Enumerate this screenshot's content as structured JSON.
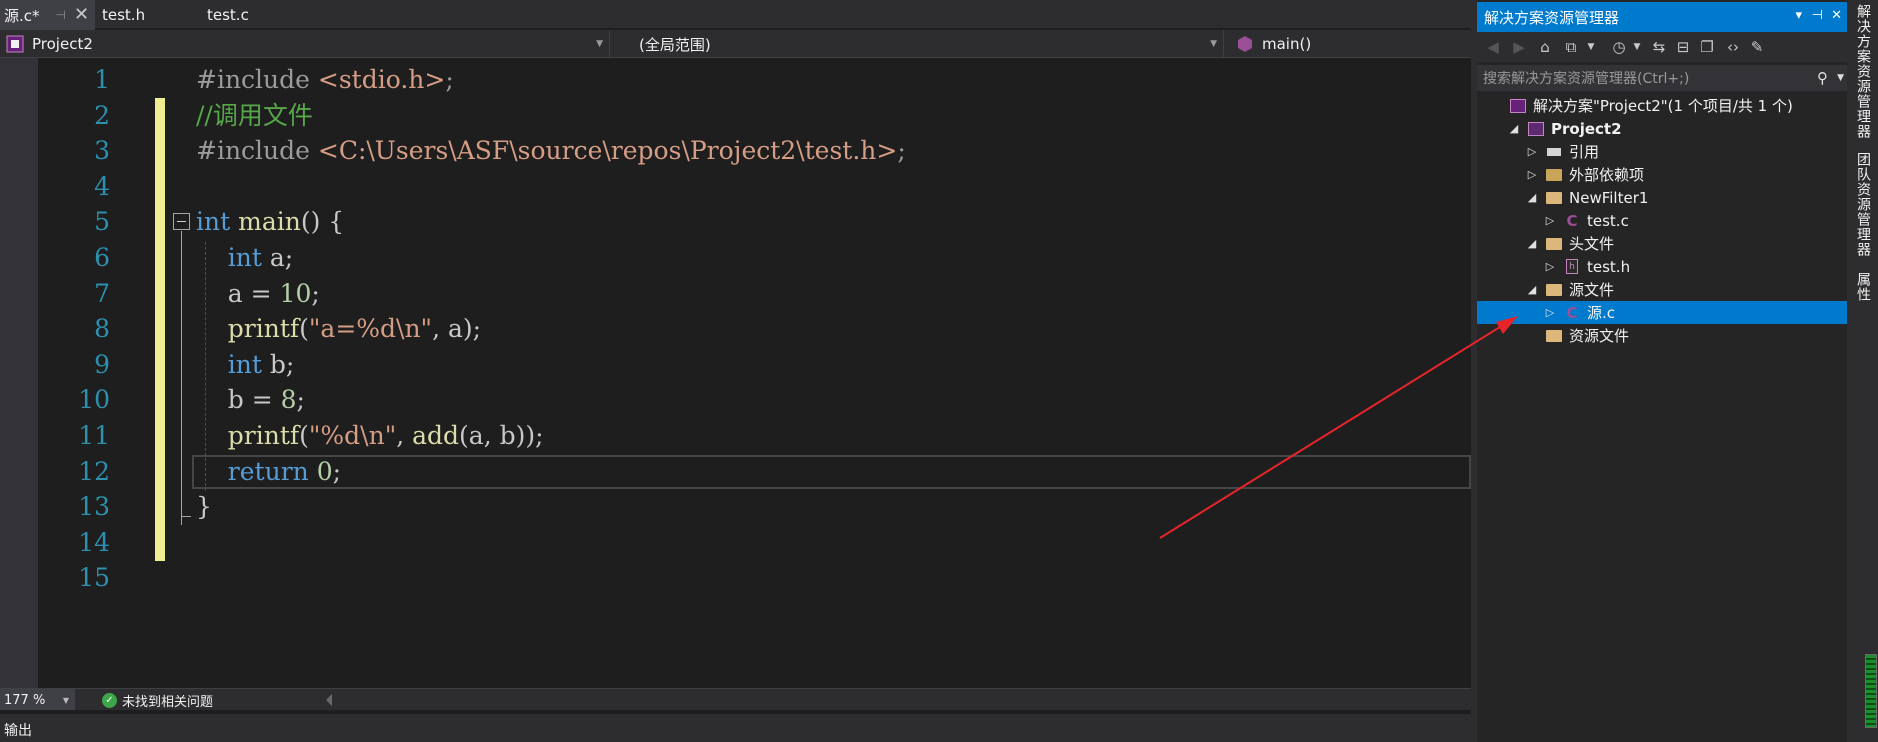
{
  "tabs": [
    {
      "label": "源.c*",
      "active": true,
      "pin": "⊣",
      "close": "✕"
    },
    {
      "label": "test.h",
      "active": false
    },
    {
      "label": "test.c",
      "active": false
    }
  ],
  "nav": {
    "project": "Project2",
    "scope": "(全局范围)",
    "member": "main()"
  },
  "editor": {
    "line_numbers": [
      "1",
      "2",
      "3",
      "4",
      "5",
      "6",
      "7",
      "8",
      "9",
      "10",
      "11",
      "12",
      "13",
      "14",
      "15"
    ],
    "lines": [
      [
        {
          "t": "#include ",
          "c": "pp"
        },
        {
          "t": "<stdio.h>",
          "c": "inc"
        },
        {
          "t": ";",
          "c": "pp"
        }
      ],
      [
        {
          "t": "//调用文件",
          "c": "cmt"
        }
      ],
      [
        {
          "t": "#include ",
          "c": "pp"
        },
        {
          "t": "<C:\\Users\\ASF\\source\\repos\\Project2\\test.h>",
          "c": "inc"
        },
        {
          "t": ";",
          "c": "pp"
        }
      ],
      [],
      [
        {
          "t": "int",
          "c": "kw"
        },
        {
          "t": " ",
          "c": "id"
        },
        {
          "t": "main",
          "c": "fn"
        },
        {
          "t": "() {",
          "c": "id"
        }
      ],
      [
        {
          "t": "    ",
          "c": "id"
        },
        {
          "t": "int",
          "c": "kw"
        },
        {
          "t": " a;",
          "c": "id"
        }
      ],
      [
        {
          "t": "    a = ",
          "c": "id"
        },
        {
          "t": "10",
          "c": "num"
        },
        {
          "t": ";",
          "c": "id"
        }
      ],
      [
        {
          "t": "    ",
          "c": "id"
        },
        {
          "t": "printf",
          "c": "fn"
        },
        {
          "t": "(",
          "c": "id"
        },
        {
          "t": "\"a=%d\\n\"",
          "c": "str"
        },
        {
          "t": ", a);",
          "c": "id"
        }
      ],
      [
        {
          "t": "    ",
          "c": "id"
        },
        {
          "t": "int",
          "c": "kw"
        },
        {
          "t": " b;",
          "c": "id"
        }
      ],
      [
        {
          "t": "    b = ",
          "c": "id"
        },
        {
          "t": "8",
          "c": "num"
        },
        {
          "t": ";",
          "c": "id"
        }
      ],
      [
        {
          "t": "    ",
          "c": "id"
        },
        {
          "t": "printf",
          "c": "fn"
        },
        {
          "t": "(",
          "c": "id"
        },
        {
          "t": "\"%d\\n\"",
          "c": "str"
        },
        {
          "t": ", ",
          "c": "id"
        },
        {
          "t": "add",
          "c": "fn"
        },
        {
          "t": "(a, b));",
          "c": "id"
        }
      ],
      [
        {
          "t": "    ",
          "c": "id"
        },
        {
          "t": "return",
          "c": "kw"
        },
        {
          "t": " ",
          "c": "id"
        },
        {
          "t": "0",
          "c": "num"
        },
        {
          "t": ";",
          "c": "id"
        }
      ],
      [
        {
          "t": "}",
          "c": "id"
        }
      ],
      [],
      []
    ],
    "zoom": "177 %",
    "issues": "未找到相关问题"
  },
  "output_panel": {
    "label": "输出"
  },
  "solution_explorer": {
    "title": "解决方案资源管理器",
    "title_buttons": {
      "dropdown": "▾",
      "pin": "⊣",
      "close": "✕"
    },
    "search_placeholder": "搜索解决方案资源管理器(Ctrl+;)",
    "tree": [
      {
        "label": "解决方案\"Project2\"(1 个项目/共 1 个)",
        "icon": "solution-icon",
        "arrow": ""
      },
      {
        "label": "Project2",
        "icon": "project-icon",
        "arrow": "◢",
        "bold": true
      },
      {
        "label": "引用",
        "icon": "references-icon",
        "arrow": "▷"
      },
      {
        "label": "外部依赖项",
        "icon": "external-deps-icon",
        "arrow": "▷"
      },
      {
        "label": "NewFilter1",
        "icon": "folder-icon",
        "arrow": "◢"
      },
      {
        "label": "test.c",
        "icon": "c-file-icon",
        "arrow": "▷"
      },
      {
        "label": "头文件",
        "icon": "folder-icon",
        "arrow": "◢"
      },
      {
        "label": "test.h",
        "icon": "h-file-icon",
        "arrow": "▷"
      },
      {
        "label": "源文件",
        "icon": "folder-icon",
        "arrow": "◢"
      },
      {
        "label": "源.c",
        "icon": "c-file-icon",
        "arrow": "▷",
        "selected": true
      },
      {
        "label": "资源文件",
        "icon": "folder-icon",
        "arrow": ""
      }
    ]
  },
  "side_tabs": [
    "解决方案资源管理器",
    "团队资源管理器",
    "属性"
  ],
  "colors": {
    "accent": "#007acc",
    "editor_bg": "#1e1e1e",
    "change_bar": "#efef91",
    "annotation_arrow": "#e5252a"
  }
}
